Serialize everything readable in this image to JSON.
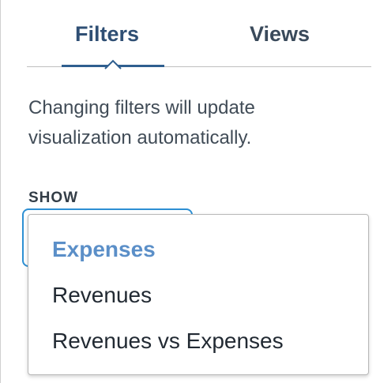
{
  "tabs": [
    {
      "label": "Filters",
      "active": true
    },
    {
      "label": "Views",
      "active": false
    }
  ],
  "description": "Changing filters will update visualization automatically.",
  "show": {
    "label": "SHOW",
    "options": [
      "Expenses",
      "Revenues",
      "Revenues vs Expenses"
    ],
    "selected": "Expenses"
  },
  "colors": {
    "accent": "#2d8fd3",
    "selected_option": "#5b8fc8",
    "tab_active": "#2f5f8f"
  }
}
